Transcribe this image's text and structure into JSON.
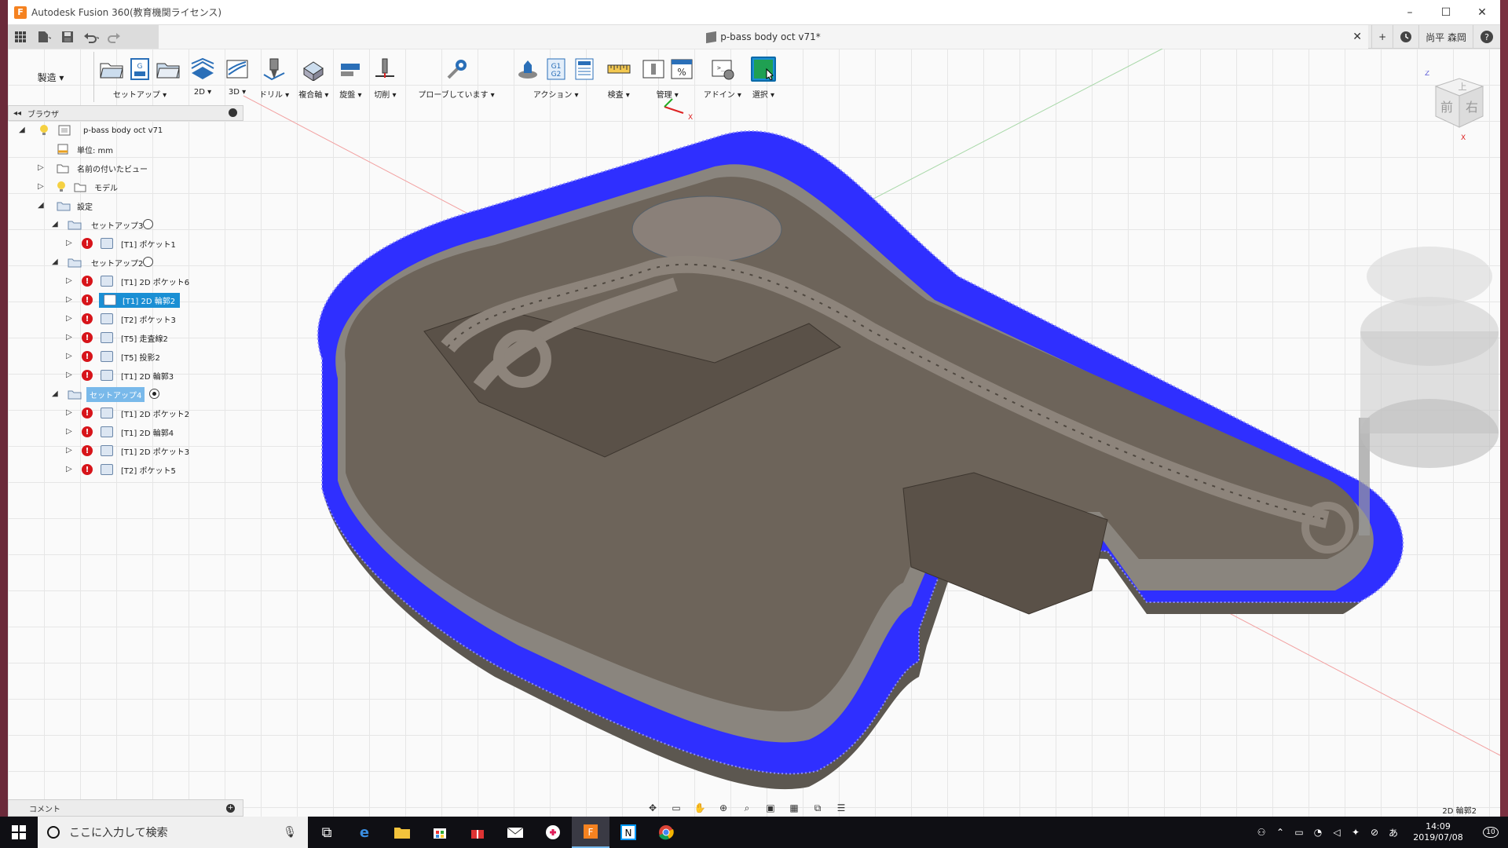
{
  "window": {
    "app_title": "Autodesk Fusion 360(教育機関ライセンス)",
    "app_icon_letter": "F",
    "min": "–",
    "max": "☐",
    "close": "✕"
  },
  "quick_access": {
    "doc_title": "p-bass body oct v71*",
    "doc_close": "✕",
    "plus": "+",
    "user": "尚平 森岡",
    "help": "?"
  },
  "toolbar": {
    "workspace": "製造 ▾",
    "groups": [
      {
        "label": "セットアップ ▾"
      },
      {
        "label": "2D ▾"
      },
      {
        "label": "3D ▾"
      },
      {
        "label": "ドリル ▾"
      },
      {
        "label": "複合軸 ▾"
      },
      {
        "label": "旋盤 ▾"
      },
      {
        "label": "切削 ▾"
      },
      {
        "label": "プローブしています ▾"
      },
      {
        "label": "アクション ▾"
      },
      {
        "label": "検査 ▾"
      },
      {
        "label": "管理 ▾"
      },
      {
        "label": "アドイン ▾"
      },
      {
        "label": "選択 ▾"
      }
    ]
  },
  "browser": {
    "title": "ブラウザ",
    "root": "p-bass body oct v71",
    "units": "単位: mm",
    "named_views": "名前の付いたビュー",
    "models": "モデル",
    "setups": "設定",
    "setup3": "セットアップ3",
    "setup3_ops": [
      "[T1] ポケット1"
    ],
    "setup2": "セットアップ2",
    "setup2_ops": [
      "[T1] 2D ポケット6",
      "[T1] 2D 輪郭2",
      "[T2] ポケット3",
      "[T5] 走査線2",
      "[T5] 投影2",
      "[T1] 2D 輪郭3"
    ],
    "setup4": "セットアップ4",
    "setup4_ops": [
      "[T1] 2D ポケット2",
      "[T1] 2D 輪郭4",
      "[T1] 2D ポケット3",
      "[T2] ポケット5"
    ],
    "error_mark": "!"
  },
  "comments": {
    "label": "コメント",
    "plus": "+"
  },
  "status": {
    "active_operation": "2D 輪郭2"
  },
  "viewcube": {
    "top": "上",
    "front": "前",
    "right": "右",
    "axis_x": "X",
    "axis_z": "Z"
  },
  "taskbar": {
    "search_placeholder": "ここに入力して検索",
    "time": "14:09",
    "date": "2019/07/08",
    "notif_count": "10"
  },
  "colors": {
    "toolpath_blue": "#2f2fff",
    "body_brown": "#6b5f53",
    "accent": "#1a8fd4",
    "error_red": "#d7141a"
  }
}
